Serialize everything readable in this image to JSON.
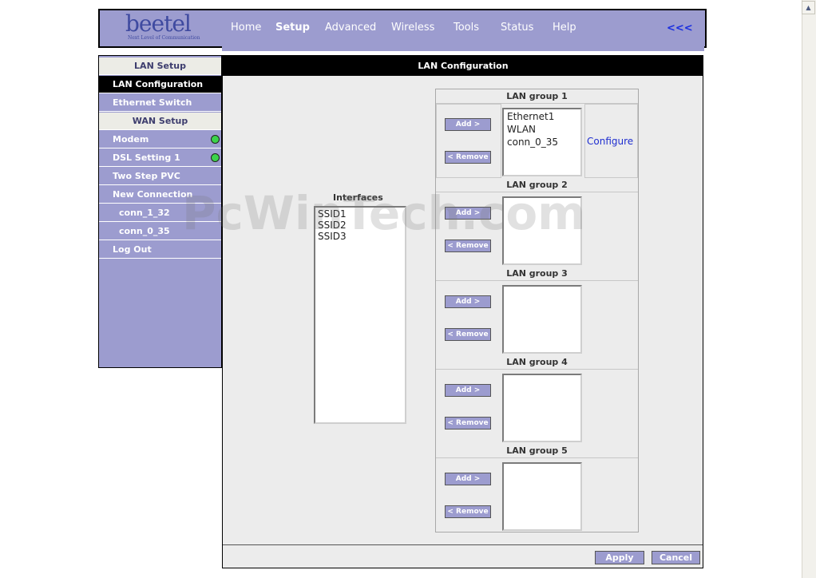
{
  "header": {
    "logo_word": "beetel",
    "logo_tagline": "Next Level of Communication",
    "nav": [
      "Home",
      "Setup",
      "Advanced",
      "Wireless",
      "Tools",
      "Status",
      "Help"
    ],
    "active_nav": "Setup",
    "collapse_label": "<<<"
  },
  "sidebar": {
    "items": [
      {
        "label": "LAN Setup",
        "kind": "section"
      },
      {
        "label": "LAN Configuration",
        "kind": "selected"
      },
      {
        "label": "Ethernet Switch",
        "kind": "item"
      },
      {
        "label": "WAN Setup",
        "kind": "section"
      },
      {
        "label": "Modem",
        "kind": "item",
        "status": "green"
      },
      {
        "label": "DSL Setting 1",
        "kind": "item",
        "status": "green"
      },
      {
        "label": "Two Step PVC",
        "kind": "item"
      },
      {
        "label": "New Connection",
        "kind": "item"
      },
      {
        "label": "conn_1_32",
        "kind": "sub"
      },
      {
        "label": "conn_0_35",
        "kind": "sub"
      },
      {
        "label": "Log Out",
        "kind": "item"
      }
    ]
  },
  "main": {
    "title": "LAN Configuration",
    "interfaces_label": "Interfaces",
    "interfaces": [
      "SSID1",
      "SSID2",
      "SSID3"
    ],
    "add_label": "Add >",
    "remove_label": "< Remove",
    "configure_label": "Configure",
    "groups": [
      {
        "title": "LAN group 1",
        "members": [
          "Ethernet1",
          "WLAN",
          "conn_0_35"
        ]
      },
      {
        "title": "LAN group 2",
        "members": []
      },
      {
        "title": "LAN group 3",
        "members": []
      },
      {
        "title": "LAN group 4",
        "members": []
      },
      {
        "title": "LAN group 5",
        "members": []
      }
    ],
    "apply_label": "Apply",
    "cancel_label": "Cancel"
  },
  "watermark": "PcWinTech.com",
  "colors": {
    "accent": "#9c9ccf",
    "title_bar": "#000000",
    "panel_bg": "#ececec",
    "status_green": "#3cd24b",
    "link": "#1f2ed0"
  }
}
